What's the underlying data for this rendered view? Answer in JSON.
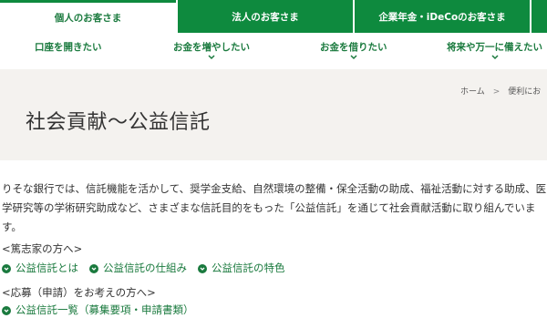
{
  "topnav": {
    "tabs": [
      {
        "label": "個人のお客さま",
        "active": true
      },
      {
        "label": "法人のお客さま",
        "active": false
      },
      {
        "label": "企業年金・iDeCoのお客さま",
        "active": false
      },
      {
        "label": "",
        "active": false
      }
    ]
  },
  "subnav": {
    "items": [
      {
        "label": "口座を開きたい",
        "has_chevron": false
      },
      {
        "label": "お金を増やしたい",
        "has_chevron": true
      },
      {
        "label": "お金を借りたい",
        "has_chevron": true
      },
      {
        "label": "将来や万一に備えたい",
        "has_chevron": true
      }
    ]
  },
  "breadcrumb": {
    "home": "ホーム",
    "separator": ">",
    "current": "便利にお"
  },
  "page": {
    "title": "社会貢献～公益信託"
  },
  "intro": {
    "text": "りそな銀行では、信託機能を活かして、奨学金支給、自然環境の整備・保全活動の助成、福祉活動に対する助成、医学研究等の学術研究助成など、さまざまな信託目的をもった「公益信託」を通じて社会貢献活動に取り組んでいます。"
  },
  "sections": {
    "donor": {
      "heading": "<篤志家の方へ>",
      "links": [
        "公益信託とは",
        "公益信託の仕組み",
        "公益信託の特色"
      ]
    },
    "applicant": {
      "heading": "<応募（申請）をお考えの方へ>",
      "link_partial": "公益信託一覧（募集要項・申請書類）"
    }
  },
  "colors": {
    "brand_green": "#0e8a3e",
    "link_green": "#1a7a3e",
    "hero_bg": "#f4f2ef"
  },
  "icons": {
    "link": "chevron-circle-icon",
    "subnav": "chevron-down-icon"
  }
}
